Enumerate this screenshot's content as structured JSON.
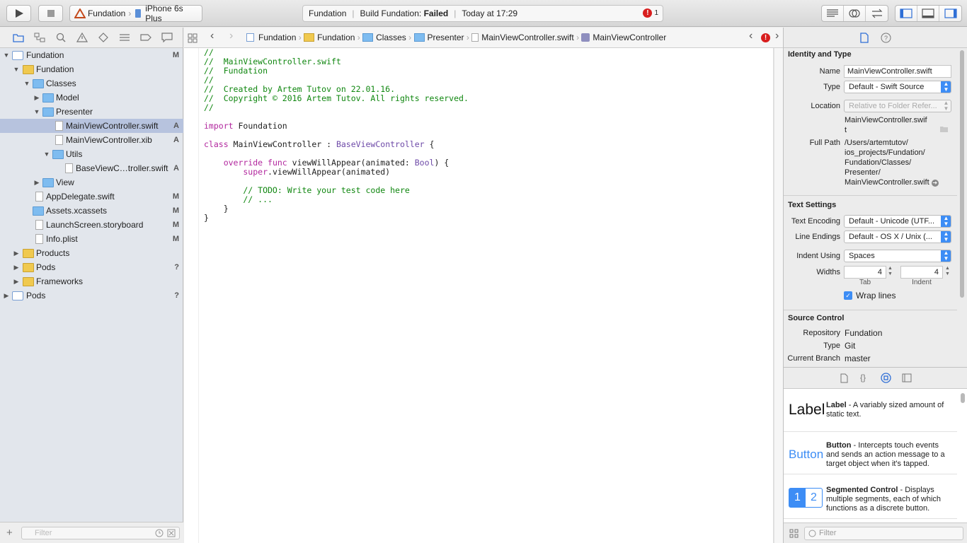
{
  "toolbar": {
    "scheme_project": "Fundation",
    "scheme_device": "iPhone 6s Plus",
    "activity_project": "Fundation",
    "activity_status_prefix": "Build Fundation: ",
    "activity_status_state": "Failed",
    "activity_time": "Today at 17:29",
    "error_count": "1",
    "error_glyph": "!"
  },
  "navigator": {
    "items": [
      {
        "label": "Fundation",
        "badge": "M"
      },
      {
        "label": "Fundation",
        "badge": ""
      },
      {
        "label": "Classes",
        "badge": ""
      },
      {
        "label": "Model",
        "badge": ""
      },
      {
        "label": "Presenter",
        "badge": ""
      },
      {
        "label": "MainViewController.swift",
        "badge": "A"
      },
      {
        "label": "MainViewController.xib",
        "badge": "A"
      },
      {
        "label": "Utils",
        "badge": ""
      },
      {
        "label": "BaseViewC…troller.swift",
        "badge": "A"
      },
      {
        "label": "View",
        "badge": ""
      },
      {
        "label": "AppDelegate.swift",
        "badge": "M"
      },
      {
        "label": "Assets.xcassets",
        "badge": "M"
      },
      {
        "label": "LaunchScreen.storyboard",
        "badge": "M"
      },
      {
        "label": "Info.plist",
        "badge": "M"
      },
      {
        "label": "Products",
        "badge": ""
      },
      {
        "label": "Pods",
        "badge": "?"
      },
      {
        "label": "Frameworks",
        "badge": ""
      },
      {
        "label": "Pods",
        "badge": "?"
      }
    ],
    "filter_placeholder": "Filter"
  },
  "jumpbar": {
    "crumbs": [
      "Fundation",
      "Fundation",
      "Classes",
      "Presenter",
      "MainViewController.swift",
      "MainViewController"
    ]
  },
  "editor": {
    "lines": [
      [
        {
          "t": "//",
          "c": "cm"
        }
      ],
      [
        {
          "t": "//  MainViewController.swift",
          "c": "cm"
        }
      ],
      [
        {
          "t": "//  Fundation",
          "c": "cm"
        }
      ],
      [
        {
          "t": "//",
          "c": "cm"
        }
      ],
      [
        {
          "t": "//  Created by Artem Tutov on 22.01.16.",
          "c": "cm"
        }
      ],
      [
        {
          "t": "//  Copyright © 2016 Artem Tutov. All rights reserved.",
          "c": "cm"
        }
      ],
      [
        {
          "t": "//",
          "c": "cm"
        }
      ],
      [],
      [
        {
          "t": "import",
          "c": "kw"
        },
        {
          "t": " Foundation",
          "c": "pl"
        }
      ],
      [],
      [
        {
          "t": "class",
          "c": "kw"
        },
        {
          "t": " MainViewController : ",
          "c": "pl"
        },
        {
          "t": "BaseViewController",
          "c": "ty"
        },
        {
          "t": " {",
          "c": "pl"
        }
      ],
      [],
      [
        {
          "t": "    override",
          "c": "kw"
        },
        {
          "t": " ",
          "c": "pl"
        },
        {
          "t": "func",
          "c": "kw"
        },
        {
          "t": " viewWillAppear(animated: ",
          "c": "pl"
        },
        {
          "t": "Bool",
          "c": "ty"
        },
        {
          "t": ") {",
          "c": "pl"
        }
      ],
      [
        {
          "t": "        super",
          "c": "kw"
        },
        {
          "t": ".viewWillAppear(animated)",
          "c": "pl"
        }
      ],
      [],
      [
        {
          "t": "        // TODO: Write your test code here",
          "c": "cm"
        }
      ],
      [
        {
          "t": "        // ...",
          "c": "cm"
        }
      ],
      [
        {
          "t": "    }",
          "c": "pl"
        }
      ],
      [
        {
          "t": "}",
          "c": "pl"
        }
      ]
    ]
  },
  "inspector": {
    "identity_title": "Identity and Type",
    "name_label": "Name",
    "name_value": "MainViewController.swift",
    "type_label": "Type",
    "type_value": "Default - Swift Source",
    "location_label": "Location",
    "location_value": "Relative to Folder Refer...",
    "location_path_1": "MainViewController.swif",
    "location_path_2": "t",
    "fullpath_label": "Full Path",
    "fullpath_lines": [
      "/Users/artemtutov/",
      "ios_projects/Fundation/",
      "Fundation/Classes/",
      "Presenter/",
      "MainViewController.swift"
    ],
    "text_settings_title": "Text Settings",
    "encoding_label": "Text Encoding",
    "encoding_value": "Default - Unicode (UTF...",
    "line_endings_label": "Line Endings",
    "line_endings_value": "Default - OS X / Unix (...",
    "indent_using_label": "Indent Using",
    "indent_using_value": "Spaces",
    "widths_label": "Widths",
    "tab_width": "4",
    "indent_width": "4",
    "tab_caption": "Tab",
    "indent_caption": "Indent",
    "wrap_label": "Wrap lines",
    "wrap_checked": true,
    "source_control_title": "Source Control",
    "repository_label": "Repository",
    "repository_value": "Fundation",
    "sc_type_label": "Type",
    "sc_type_value": "Git",
    "branch_label": "Current Branch",
    "branch_value": "master"
  },
  "library": {
    "items": [
      {
        "preview": "Label",
        "title": "Label",
        "desc": " - A variably sized amount of static text."
      },
      {
        "preview": "Button",
        "title": "Button",
        "desc": " - Intercepts touch events and sends an action message to a target object when it's tapped."
      },
      {
        "preview_1": "1",
        "preview_2": "2",
        "title": "Segmented Control",
        "desc": " - Displays multiple segments, each of which functions as a discrete button."
      }
    ],
    "filter_placeholder": "Filter"
  },
  "colors": {
    "accent": "#3d8df5",
    "error": "#d81e1e",
    "selection": "#b7c3de",
    "comment": "#108710",
    "keyword": "#b2279e"
  }
}
